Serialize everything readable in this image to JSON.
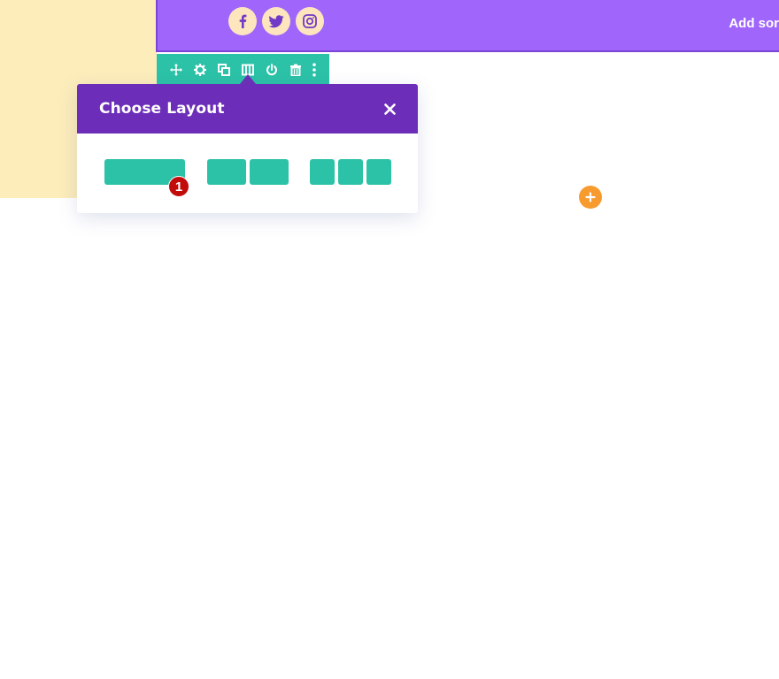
{
  "header": {
    "text": "Add sor",
    "social": [
      {
        "icon": "facebook-icon"
      },
      {
        "icon": "twitter-icon"
      },
      {
        "icon": "instagram-icon"
      }
    ]
  },
  "toolbar": {
    "icons": [
      "move-icon",
      "gear-icon",
      "duplicate-icon",
      "columns-icon",
      "power-icon",
      "trash-icon",
      "more-icon"
    ]
  },
  "modal": {
    "title": "Choose Layout",
    "close_icon": "close-icon",
    "layouts": [
      {
        "columns": 1
      },
      {
        "columns": 2
      },
      {
        "columns": 3
      }
    ]
  },
  "badge": {
    "text": "1"
  },
  "add_button": {
    "icon": "plus-icon"
  },
  "colors": {
    "header_purple": "#a066fb",
    "modal_purple": "#6c2eb8",
    "teal": "#2bc2a7",
    "cream": "#fdedbb",
    "social_bg": "#fde6bd",
    "orange": "#f79b2f",
    "badge_red": "#c20c0c"
  }
}
